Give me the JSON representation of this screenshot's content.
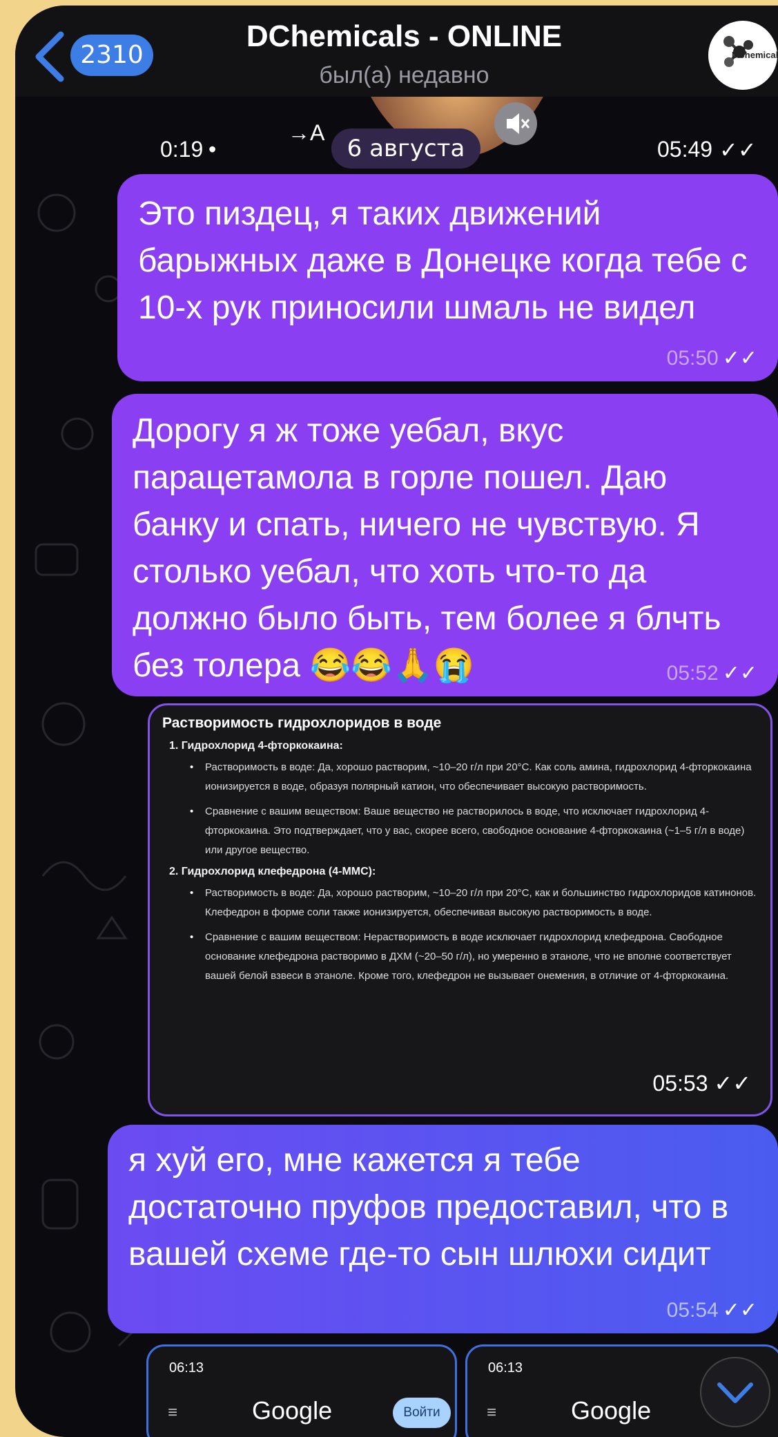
{
  "header": {
    "unread_count": "2310",
    "title": "DChemicals - ONLINE",
    "status": "был(а) недавно",
    "avatar_label": "DChemicals"
  },
  "video_message": {
    "duration": "0:19",
    "forward_label": "→A",
    "time": "05:49",
    "ticks": "✓✓"
  },
  "date_separator": "6 августа",
  "messages": [
    {
      "text": "Это пиздец, я таких движений барыжных даже в Донецке когда тебе с 10-х рук приносили шмаль не видел",
      "time": "05:50",
      "ticks": "✓✓"
    },
    {
      "text": "Дорогу я ж тоже уебал, вкус парацетамола в горле пошел. Даю банку и спать, ничего не чувствую. Я столько уебал, что хоть что-то да должно было быть, тем более я блчть без толера 😂😂🙏😭",
      "time": "05:52",
      "ticks": "✓✓"
    },
    {
      "text": "я хуй его, мне кажется я тебе достаточно пруфов предоставил, что в вашей схеме где-то сын шлюхи сидит",
      "time": "05:54",
      "ticks": "✓✓"
    }
  ],
  "screenshot_card": {
    "heading": "Растворимость гидрохлоридов в воде",
    "sections": [
      {
        "title": "1. Гидрохлорид 4-фторкокаина:",
        "bullets": [
          "Растворимость в воде: Да, хорошо растворим, ~10–20 г/л при 20°C. Как соль амина, гидрохлорид 4-фторкокаина ионизируется в воде, образуя полярный катион, что обеспечивает высокую растворимость.",
          "Сравнение с вашим веществом: Ваше вещество не растворилось в воде, что исключает гидрохлорид 4-фторкокаина. Это подтверждает, что у вас, скорее всего, свободное основание 4-фторкокаина (~1–5 г/л в воде) или другое вещество."
        ]
      },
      {
        "title": "2. Гидрохлорид клефедрона (4-ММС):",
        "bullets": [
          "Растворимость в воде: Да, хорошо растворим, ~10–20 г/л при 20°C, как и большинство гидрохлоридов катинонов. Клефедрон в форме соли также ионизируется, обеспечивая высокую растворимость в воде.",
          "Сравнение с вашим веществом: Нерастворимость в воде исключает гидрохлорид клефедрона. Свободное основание клефедрона растворимо в ДХМ (~20–50 г/л), но умеренно в этаноле, что не вполне соответствует вашей белой взвеси в этаноле. Кроме того, клефедрон не вызывает онемения, в отличие от 4-фторкокаина."
        ]
      }
    ],
    "time": "05:53",
    "ticks": "✓✓"
  },
  "phone_screenshots": [
    {
      "time": "06:13",
      "brand": "Google",
      "login_label": "Войти"
    },
    {
      "time": "06:13",
      "brand": "Google"
    }
  ],
  "colors": {
    "accent_bubble": "#8a3ff2",
    "badge": "#3d7de6",
    "background_outer": "#f2d48a"
  }
}
